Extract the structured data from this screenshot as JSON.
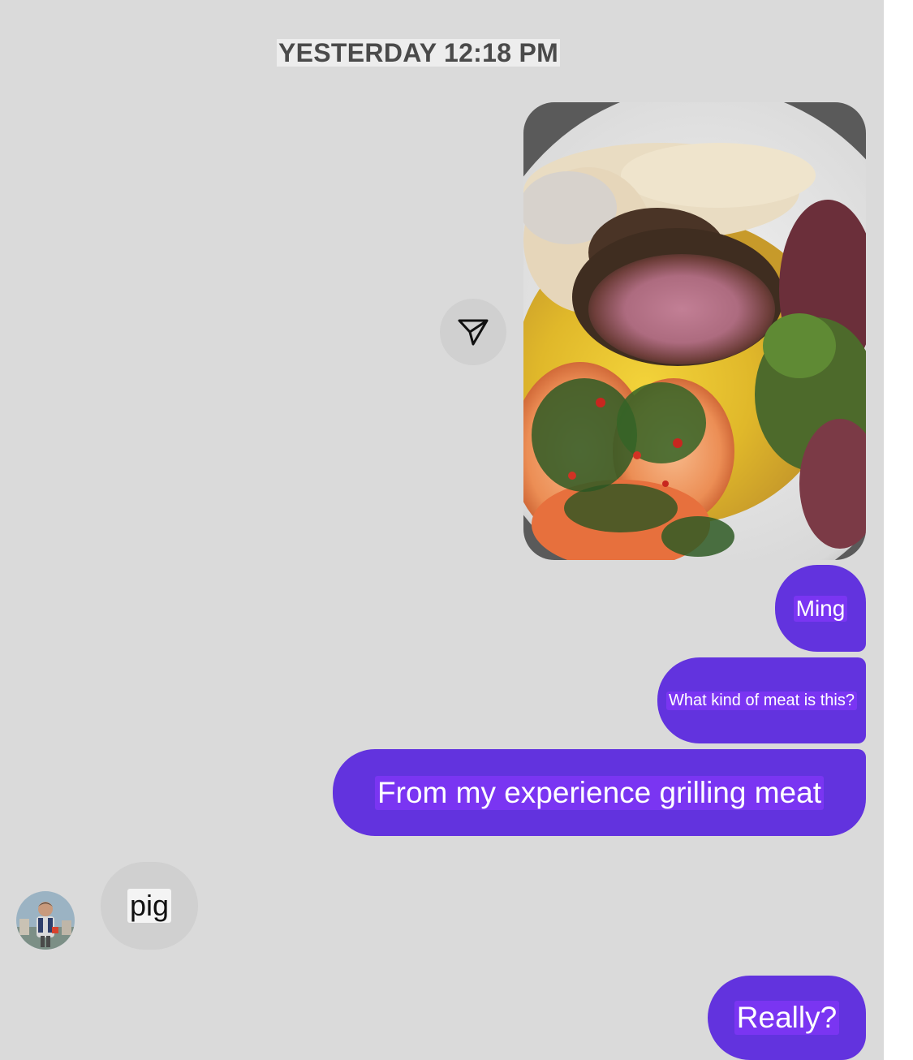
{
  "conversation": {
    "timestamp": "YESTERDAY 12:18 PM"
  },
  "messages": [
    {
      "sender": "me",
      "type": "photo",
      "content": "food-photo"
    },
    {
      "sender": "me",
      "type": "text",
      "text": "Ming"
    },
    {
      "sender": "me",
      "type": "text",
      "text": "What kind of meat is this?"
    },
    {
      "sender": "me",
      "type": "text",
      "text": "From my experience grilling meat"
    },
    {
      "sender": "them",
      "type": "text",
      "text": "pig"
    },
    {
      "sender": "me",
      "type": "text",
      "text": "Really?"
    }
  ],
  "icons": {
    "share": "send-arrow-icon",
    "avatar": "contact-avatar"
  },
  "colors": {
    "background": "#dadada",
    "sent_bubble": "#6233de",
    "received_bubble": "#d0d0d0",
    "sent_text": "#ffffff",
    "received_text": "#111111"
  }
}
